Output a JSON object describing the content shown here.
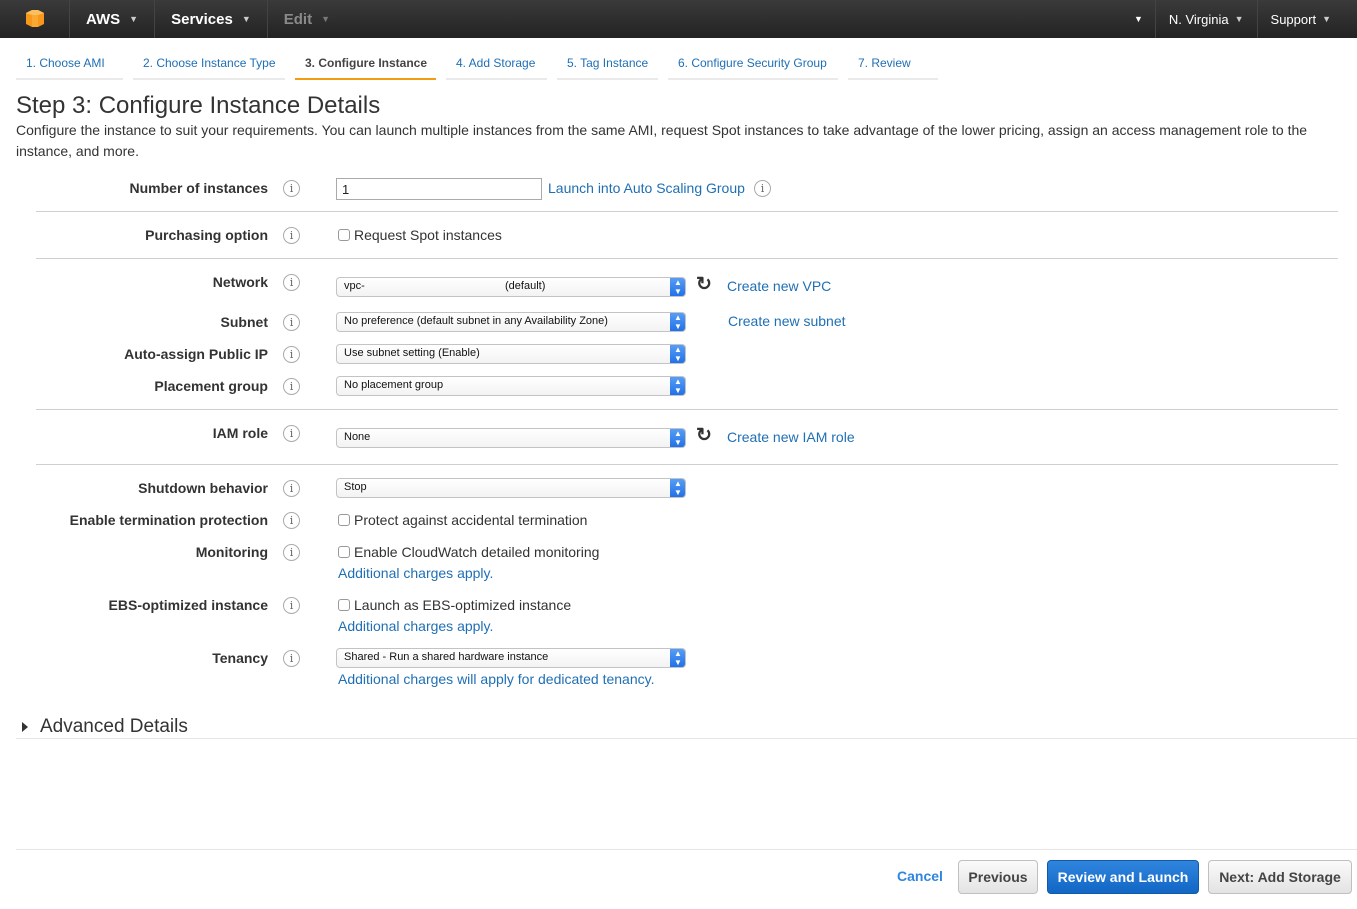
{
  "topnav": {
    "logo": "aws-cube-logo",
    "items": [
      {
        "label": "AWS",
        "enabled": true
      },
      {
        "label": "Services",
        "enabled": true
      },
      {
        "label": "Edit",
        "enabled": false
      }
    ],
    "right_items": [
      {
        "label": ""
      },
      {
        "label": "N. Virginia"
      },
      {
        "label": "Support"
      }
    ]
  },
  "tabs": [
    {
      "label": "1. Choose AMI",
      "active": false
    },
    {
      "label": "2. Choose Instance Type",
      "active": false
    },
    {
      "label": "3. Configure Instance",
      "active": true
    },
    {
      "label": "4. Add Storage",
      "active": false
    },
    {
      "label": "5. Tag Instance",
      "active": false
    },
    {
      "label": "6. Configure Security Group",
      "active": false
    },
    {
      "label": "7. Review",
      "active": false
    }
  ],
  "page": {
    "title": "Step 3: Configure Instance Details",
    "description": "Configure the instance to suit your requirements. You can launch multiple instances from the same AMI, request Spot instances to take advantage of the lower pricing, assign an access management role to the instance, and more."
  },
  "form": {
    "number_of_instances": {
      "label": "Number of instances",
      "value": "1",
      "link": "Launch into Auto Scaling Group"
    },
    "purchasing_option": {
      "label": "Purchasing option",
      "checkbox": "Request Spot instances",
      "checked": false
    },
    "network": {
      "label": "Network",
      "value_prefix": "vpc-",
      "value_suffix": "(default)",
      "link": "Create new VPC"
    },
    "subnet": {
      "label": "Subnet",
      "value": "No preference (default subnet in any Availability Zone)",
      "link": "Create new subnet"
    },
    "auto_assign_ip": {
      "label": "Auto-assign Public IP",
      "value": "Use subnet setting (Enable)"
    },
    "placement_group": {
      "label": "Placement group",
      "value": "No placement group"
    },
    "iam_role": {
      "label": "IAM role",
      "value": "None",
      "link": "Create new IAM role"
    },
    "shutdown_behavior": {
      "label": "Shutdown behavior",
      "value": "Stop"
    },
    "termination_protection": {
      "label": "Enable termination protection",
      "checkbox": "Protect against accidental termination",
      "checked": false
    },
    "monitoring": {
      "label": "Monitoring",
      "checkbox": "Enable CloudWatch detailed monitoring",
      "checked": false,
      "link": "Additional charges apply."
    },
    "ebs_optimized": {
      "label": "EBS-optimized instance",
      "checkbox": "Launch as EBS-optimized instance",
      "checked": false,
      "link": "Additional charges apply."
    },
    "tenancy": {
      "label": "Tenancy",
      "value": "Shared - Run a shared hardware instance",
      "link": "Additional charges will apply for dedicated tenancy."
    }
  },
  "advanced": {
    "label": "Advanced Details",
    "expanded": false
  },
  "footer": {
    "cancel": "Cancel",
    "previous": "Previous",
    "review_launch": "Review and Launch",
    "next": "Next: Add Storage"
  },
  "colors": {
    "link": "#1f6fb5",
    "active_tab_accent": "#f39c12",
    "primary_button": "#1a73d1",
    "logo": "#f7981d"
  },
  "info_glyph": "i"
}
